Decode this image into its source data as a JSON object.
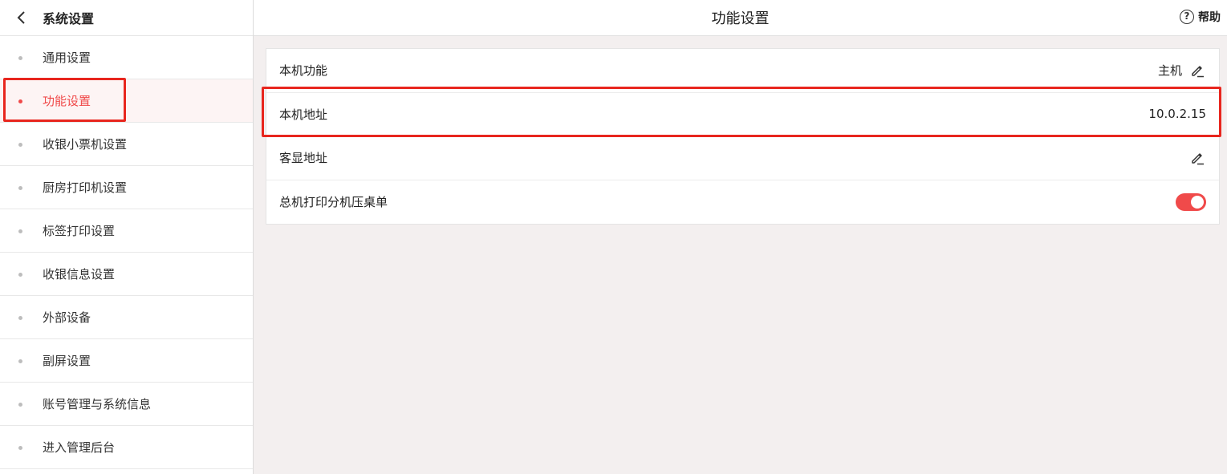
{
  "sidebar": {
    "title": "系统设置",
    "items": [
      {
        "label": "通用设置"
      },
      {
        "label": "功能设置"
      },
      {
        "label": "收银小票机设置"
      },
      {
        "label": "厨房打印机设置"
      },
      {
        "label": "标签打印设置"
      },
      {
        "label": "收银信息设置"
      },
      {
        "label": "外部设备"
      },
      {
        "label": "副屏设置"
      },
      {
        "label": "账号管理与系统信息"
      },
      {
        "label": "进入管理后台"
      }
    ],
    "active_index": 1
  },
  "header": {
    "title": "功能设置",
    "help_label": "帮助",
    "help_icon": "?"
  },
  "settings": {
    "rows": [
      {
        "label": "本机功能",
        "value": "主机",
        "editable": true
      },
      {
        "label": "本机地址",
        "value": "10.0.2.15",
        "editable": false
      },
      {
        "label": "客显地址",
        "value": "",
        "editable": true
      },
      {
        "label": "总机打印分机压桌单",
        "toggle": true
      }
    ]
  },
  "colors": {
    "accent": "#f04a4a",
    "highlight": "#e8261e"
  }
}
